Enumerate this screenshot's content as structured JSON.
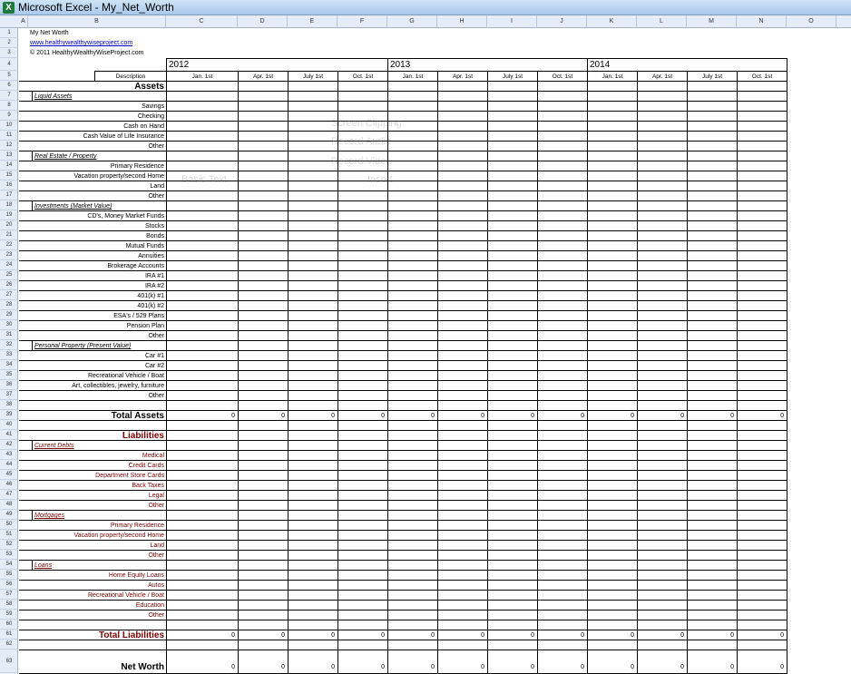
{
  "window": {
    "title": "Microsoft Excel - My_Net_Worth"
  },
  "columns": [
    "A",
    "B",
    "C",
    "D",
    "E",
    "F",
    "G",
    "H",
    "I",
    "J",
    "K",
    "L",
    "M",
    "N",
    "O"
  ],
  "header": {
    "title": "My Net Worth",
    "url": "www.healthywealthywiseproject.com",
    "copyright": "© 2011 HealthyWealthyWiseProject.com",
    "description_label": "Description",
    "years": [
      "2012",
      "2013",
      "2014"
    ],
    "quarters": [
      "Jan. 1st",
      "Apr. 1st",
      "July 1st",
      "Oct. 1st",
      "Jan. 1st",
      "Apr. 1st",
      "July 1st",
      "Oct. 1st",
      "Jan. 1st",
      "Apr. 1st",
      "July 1st",
      "Oct. 1st"
    ]
  },
  "rows": [
    {
      "n": "6",
      "text": "Assets",
      "kind": "big"
    },
    {
      "n": "7",
      "text": "Liquid Assets",
      "kind": "sect"
    },
    {
      "n": "8",
      "text": "Savings",
      "kind": "item"
    },
    {
      "n": "9",
      "text": "Checking",
      "kind": "item"
    },
    {
      "n": "10",
      "text": "Cash on Hand",
      "kind": "item"
    },
    {
      "n": "11",
      "text": "Cash Value of Life Insurance",
      "kind": "item"
    },
    {
      "n": "12",
      "text": "Other",
      "kind": "item"
    },
    {
      "n": "13",
      "text": "Real Estate / Property",
      "kind": "sect"
    },
    {
      "n": "14",
      "text": "Primary Residence",
      "kind": "item"
    },
    {
      "n": "15",
      "text": "Vacation property/second Home",
      "kind": "item"
    },
    {
      "n": "16",
      "text": "Land",
      "kind": "item"
    },
    {
      "n": "17",
      "text": "Other",
      "kind": "item"
    },
    {
      "n": "18",
      "text": "Investments (Market Value)",
      "kind": "sect"
    },
    {
      "n": "19",
      "text": "CD's, Money Market Funds",
      "kind": "item"
    },
    {
      "n": "20",
      "text": "Stocks",
      "kind": "item"
    },
    {
      "n": "21",
      "text": "Bonds",
      "kind": "item"
    },
    {
      "n": "22",
      "text": "Mutual Funds",
      "kind": "item"
    },
    {
      "n": "23",
      "text": "Annuities",
      "kind": "item"
    },
    {
      "n": "24",
      "text": "Brokerage Accounts",
      "kind": "item"
    },
    {
      "n": "25",
      "text": "IRA #1",
      "kind": "item"
    },
    {
      "n": "26",
      "text": "IRA #2",
      "kind": "item"
    },
    {
      "n": "27",
      "text": "401(k) #1",
      "kind": "item"
    },
    {
      "n": "28",
      "text": "401(k) #2",
      "kind": "item"
    },
    {
      "n": "29",
      "text": "ESA's / 529 Plans",
      "kind": "item"
    },
    {
      "n": "30",
      "text": "Pension Plan",
      "kind": "item"
    },
    {
      "n": "31",
      "text": "Other",
      "kind": "item"
    },
    {
      "n": "32",
      "text": "Personal Property (Present Value)",
      "kind": "sect"
    },
    {
      "n": "33",
      "text": "Car #1",
      "kind": "item"
    },
    {
      "n": "34",
      "text": "Car #2",
      "kind": "item"
    },
    {
      "n": "35",
      "text": "Recreational Vehicle / Boat",
      "kind": "item"
    },
    {
      "n": "36",
      "text": "Art, collectibles, jewelry, furniture",
      "kind": "item"
    },
    {
      "n": "37",
      "text": "Other",
      "kind": "item"
    },
    {
      "n": "38",
      "text": "",
      "kind": "blank"
    },
    {
      "n": "39",
      "text": "Total Assets",
      "kind": "total"
    },
    {
      "n": "40",
      "text": "",
      "kind": "blank"
    },
    {
      "n": "41",
      "text": "Liabilities",
      "kind": "bigliab"
    },
    {
      "n": "42",
      "text": "Current Debts",
      "kind": "sectliab"
    },
    {
      "n": "43",
      "text": "Medical",
      "kind": "itemliab"
    },
    {
      "n": "44",
      "text": "Credit Cards",
      "kind": "itemliab"
    },
    {
      "n": "45",
      "text": "Department Store Cards",
      "kind": "itemliab"
    },
    {
      "n": "46",
      "text": "Back Taxes",
      "kind": "itemliab"
    },
    {
      "n": "47",
      "text": "Legal",
      "kind": "itemliab"
    },
    {
      "n": "48",
      "text": "Other",
      "kind": "itemliab"
    },
    {
      "n": "49",
      "text": "Mortgages",
      "kind": "sectliab"
    },
    {
      "n": "50",
      "text": "Primary Residence",
      "kind": "itemliab"
    },
    {
      "n": "51",
      "text": "Vacation property/second Home",
      "kind": "itemliab"
    },
    {
      "n": "52",
      "text": "Land",
      "kind": "itemliab"
    },
    {
      "n": "53",
      "text": "Other",
      "kind": "itemliab"
    },
    {
      "n": "54",
      "text": "Loans",
      "kind": "sectliab"
    },
    {
      "n": "55",
      "text": "Home Equity Loans",
      "kind": "itemliab"
    },
    {
      "n": "56",
      "text": "Autos",
      "kind": "itemliab"
    },
    {
      "n": "57",
      "text": "Recreational Vehicle / Boat",
      "kind": "itemliab"
    },
    {
      "n": "58",
      "text": "Education",
      "kind": "itemliab"
    },
    {
      "n": "59",
      "text": "Other",
      "kind": "itemliab"
    },
    {
      "n": "60",
      "text": "",
      "kind": "blank"
    },
    {
      "n": "61",
      "text": "Total Liabilities",
      "kind": "totalliab"
    },
    {
      "n": "62",
      "text": "",
      "kind": "blank"
    },
    {
      "n": "63",
      "text": "Net Worth",
      "kind": "net"
    }
  ],
  "totals": {
    "total_assets": [
      "0",
      "0",
      "0",
      "0",
      "0",
      "0",
      "0",
      "0",
      "0",
      "0",
      "0",
      "0"
    ],
    "total_liabilities": [
      "0",
      "0",
      "0",
      "0",
      "0",
      "0",
      "0",
      "0",
      "0",
      "0",
      "0",
      "0"
    ],
    "net_worth": [
      "0",
      "0",
      "0",
      "0",
      "0",
      "0",
      "0",
      "0",
      "0",
      "0",
      "0",
      "0"
    ]
  },
  "ghost_overlay": {
    "items": [
      "Screen Clipping",
      "Record Audio",
      "Record Video",
      "Basic Text",
      "Insert"
    ]
  }
}
